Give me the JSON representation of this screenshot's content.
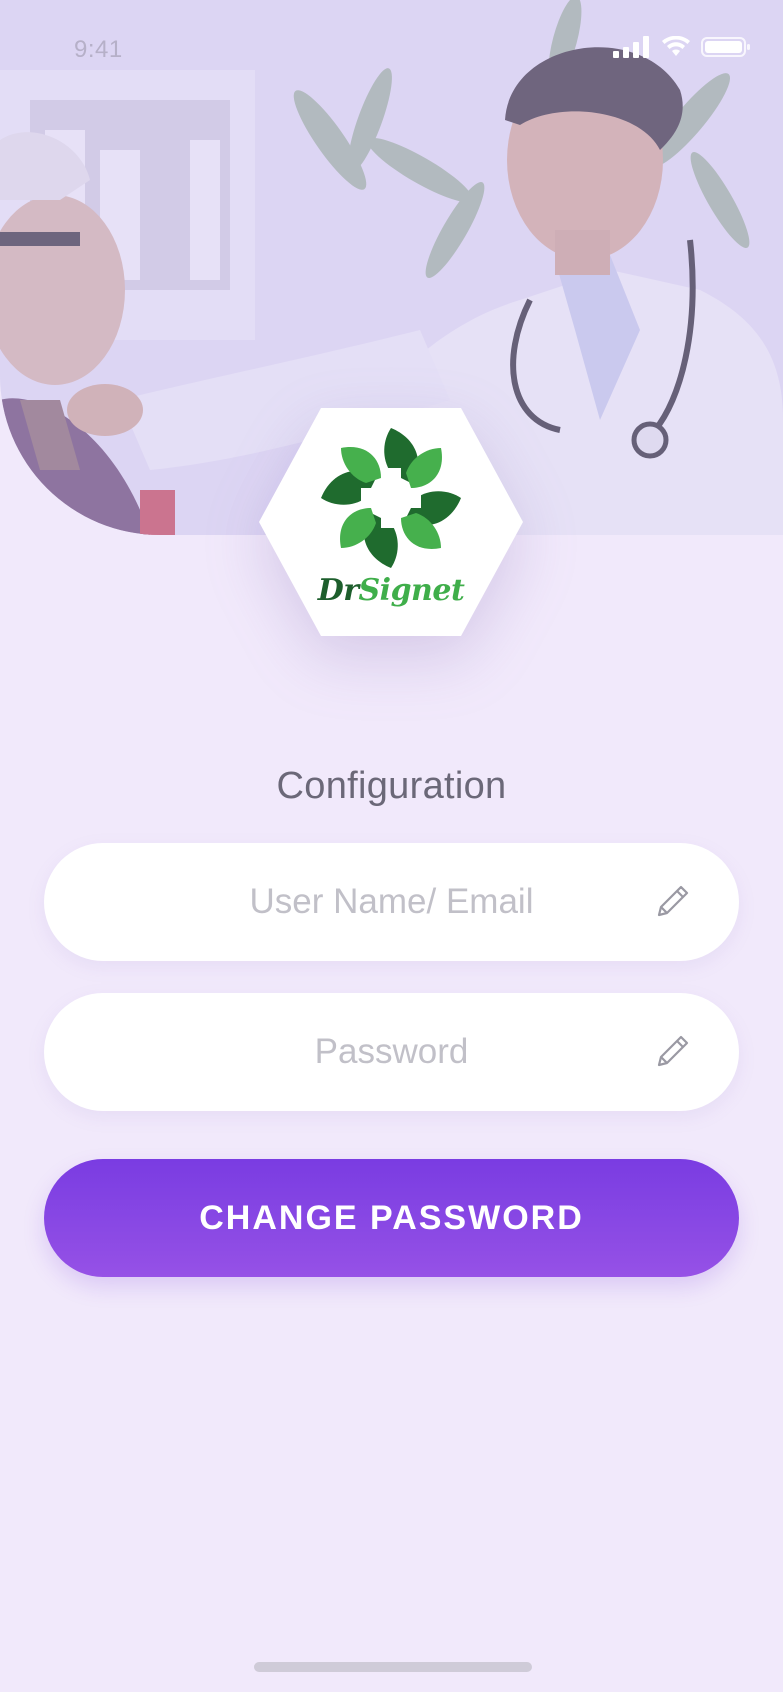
{
  "status_bar": {
    "time": "9:41",
    "icons": [
      "signal-icon",
      "wifi-icon",
      "battery-icon"
    ]
  },
  "hero": {
    "image": "doctor-consulting-patient-photo"
  },
  "logo": {
    "icon": "leaf-cross-logo",
    "brand_part1": "Dr",
    "brand_part2": "Signet",
    "colors": {
      "dark_green": "#1d5e2c",
      "light_green": "#3fae4a"
    }
  },
  "form": {
    "title": "Configuration",
    "username": {
      "placeholder": "User Name/ Email",
      "value": "",
      "icon": "pencil-icon"
    },
    "password": {
      "placeholder": "Password",
      "value": "",
      "icon": "pencil-icon"
    },
    "submit_label": "CHANGE PASSWORD"
  },
  "theme": {
    "background": "#f1e9fb",
    "accent": "#7a3ce2",
    "accent_light": "#9651e6"
  }
}
